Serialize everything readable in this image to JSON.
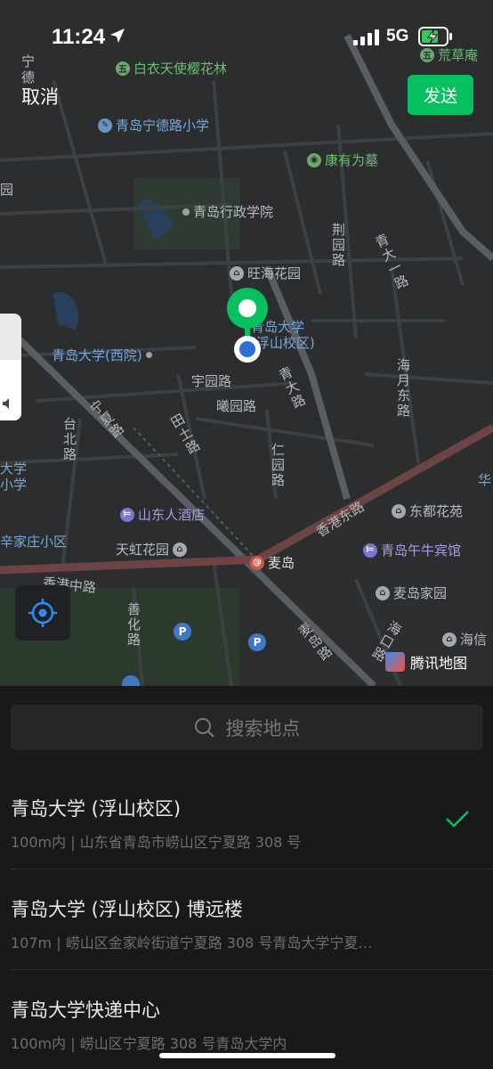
{
  "status_bar": {
    "time": "11:24",
    "network": "5G"
  },
  "header": {
    "cancel_label": "取消",
    "send_label": "发送"
  },
  "map": {
    "pois": [
      {
        "label": "白衣天使樱花林",
        "color": "green",
        "icon": "tree-icon"
      },
      {
        "label": "荒草庵",
        "color": "green",
        "icon": "temple-icon"
      },
      {
        "label": "青岛宁德路小学",
        "color": "blue",
        "icon": "school-icon"
      },
      {
        "label": "康有为墓",
        "color": "green",
        "icon": "scenic-icon"
      },
      {
        "label": "青岛行政学院",
        "color": "gray",
        "icon": "dot-icon"
      },
      {
        "label": "旺海花园",
        "color": "gray",
        "icon": "residential-icon"
      },
      {
        "label": "青岛大学\n(浮山校区)",
        "color": "blue",
        "icon": "school-icon"
      },
      {
        "label": "青岛大学(西院)",
        "color": "blue",
        "icon": "dot-icon"
      },
      {
        "label": "山东人酒店",
        "color": "purple",
        "icon": "hotel-icon"
      },
      {
        "label": "天虹花园",
        "color": "gray",
        "icon": "residential-icon"
      },
      {
        "label": "东都花苑",
        "color": "gray",
        "icon": "residential-icon"
      },
      {
        "label": "青岛午牛宾馆",
        "color": "purple",
        "icon": "hotel-icon"
      },
      {
        "label": "麦岛",
        "color": "red",
        "icon": "metro-icon"
      },
      {
        "label": "麦岛家园",
        "color": "gray",
        "icon": "residential-icon"
      },
      {
        "label": "海信",
        "color": "gray",
        "icon": "residential-icon"
      },
      {
        "label": "辛家庄小区",
        "color": "blue",
        "icon": "none"
      },
      {
        "label": "大学\n小学",
        "color": "blue",
        "icon": "none"
      },
      {
        "label": "宁\n德",
        "color": "gray",
        "icon": "none"
      },
      {
        "label": "园",
        "color": "gray",
        "icon": "none"
      },
      {
        "label": "华",
        "color": "blue",
        "icon": "none"
      }
    ],
    "roads": [
      "荆园路",
      "青大一路",
      "宇园路",
      "曦园路",
      "青大路",
      "海月东路",
      "宁夏路",
      "台北路",
      "田土路",
      "仁园路",
      "香港东路",
      "香港中路",
      "善化路",
      "麦岛路",
      "海口路"
    ],
    "parking_label": "P",
    "brand": "腾讯地图"
  },
  "search": {
    "placeholder": "搜索地点"
  },
  "results": [
    {
      "name": "青岛大学 (浮山校区)",
      "address": "100m内 | 山东省青岛市崂山区宁夏路 308 号",
      "selected": true
    },
    {
      "name": "青岛大学 (浮山校区) 博远楼",
      "address": "107m | 崂山区金家岭街道宁夏路 308 号青岛大学宁夏…",
      "selected": false
    },
    {
      "name": "青岛大学快递中心",
      "address": "100m内 | 崂山区宁夏路 308 号青岛大学内",
      "selected": false
    }
  ],
  "colors": {
    "accent": "#07c160",
    "map_bg": "#2b2d2f",
    "sheet_bg": "#191919",
    "road": "#3f4245",
    "major_road": "#7a4a4a"
  }
}
